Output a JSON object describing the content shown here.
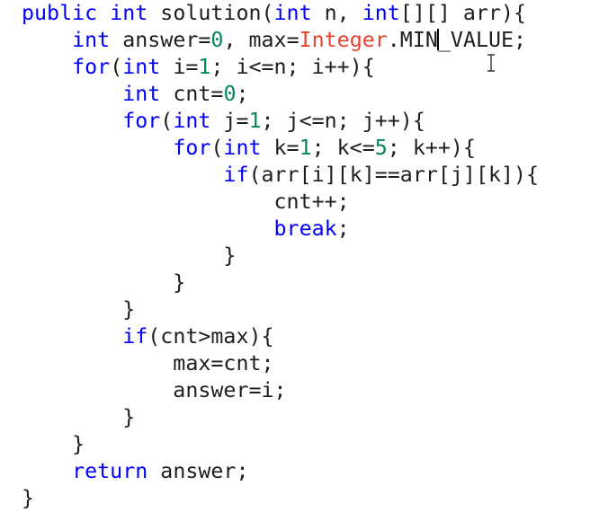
{
  "editor": {
    "lines": [
      [
        {
          "t": "public",
          "c": "kw"
        },
        {
          "t": " "
        },
        {
          "t": "int",
          "c": "kw"
        },
        {
          "t": " solution("
        },
        {
          "t": "int",
          "c": "kw"
        },
        {
          "t": " n, "
        },
        {
          "t": "int",
          "c": "kw"
        },
        {
          "t": "[][] arr){"
        }
      ],
      [
        {
          "t": "    "
        },
        {
          "t": "int",
          "c": "kw"
        },
        {
          "t": " answer="
        },
        {
          "t": "0",
          "c": "num"
        },
        {
          "t": ", max="
        },
        {
          "t": "Integer",
          "c": "cls"
        },
        {
          "t": ".MIN"
        },
        {
          "caret": true
        },
        {
          "t": "_VALUE;"
        }
      ],
      [
        {
          "t": "    "
        },
        {
          "t": "for",
          "c": "kw"
        },
        {
          "t": "("
        },
        {
          "t": "int",
          "c": "kw"
        },
        {
          "t": " i="
        },
        {
          "t": "1",
          "c": "num"
        },
        {
          "t": "; i<=n; i++){"
        }
      ],
      [
        {
          "t": "        "
        },
        {
          "t": "int",
          "c": "kw"
        },
        {
          "t": " cnt="
        },
        {
          "t": "0",
          "c": "num"
        },
        {
          "t": ";"
        }
      ],
      [
        {
          "t": "        "
        },
        {
          "t": "for",
          "c": "kw"
        },
        {
          "t": "("
        },
        {
          "t": "int",
          "c": "kw"
        },
        {
          "t": " j="
        },
        {
          "t": "1",
          "c": "num"
        },
        {
          "t": "; j<=n; j++){"
        }
      ],
      [
        {
          "t": "            "
        },
        {
          "t": "for",
          "c": "kw"
        },
        {
          "t": "("
        },
        {
          "t": "int",
          "c": "kw"
        },
        {
          "t": " k="
        },
        {
          "t": "1",
          "c": "num"
        },
        {
          "t": "; k<="
        },
        {
          "t": "5",
          "c": "num"
        },
        {
          "t": "; k++){"
        }
      ],
      [
        {
          "t": "                "
        },
        {
          "t": "if",
          "c": "kw"
        },
        {
          "t": "(arr[i][k]==arr[j][k]){"
        }
      ],
      [
        {
          "t": "                    cnt++;"
        }
      ],
      [
        {
          "t": "                    "
        },
        {
          "t": "break",
          "c": "kw"
        },
        {
          "t": ";"
        }
      ],
      [
        {
          "t": "                }"
        }
      ],
      [
        {
          "t": "            }"
        }
      ],
      [
        {
          "t": "        }"
        }
      ],
      [
        {
          "t": "        "
        },
        {
          "t": "if",
          "c": "kw"
        },
        {
          "t": "(cnt>max){"
        }
      ],
      [
        {
          "t": "            max=cnt;"
        }
      ],
      [
        {
          "t": "            answer=i;"
        }
      ],
      [
        {
          "t": "        }"
        }
      ],
      [
        {
          "t": "    }"
        }
      ],
      [
        {
          "t": "    "
        },
        {
          "t": "return",
          "c": "kw"
        },
        {
          "t": " answer;"
        }
      ],
      [
        {
          "t": "}"
        }
      ]
    ]
  },
  "cursor": {
    "icon": "text-cursor-icon"
  },
  "colors": {
    "keyword": "#0000ff",
    "number": "#098658",
    "class_name": "#e5432f",
    "text": "#1e1e1e",
    "background": "#ffffff"
  }
}
